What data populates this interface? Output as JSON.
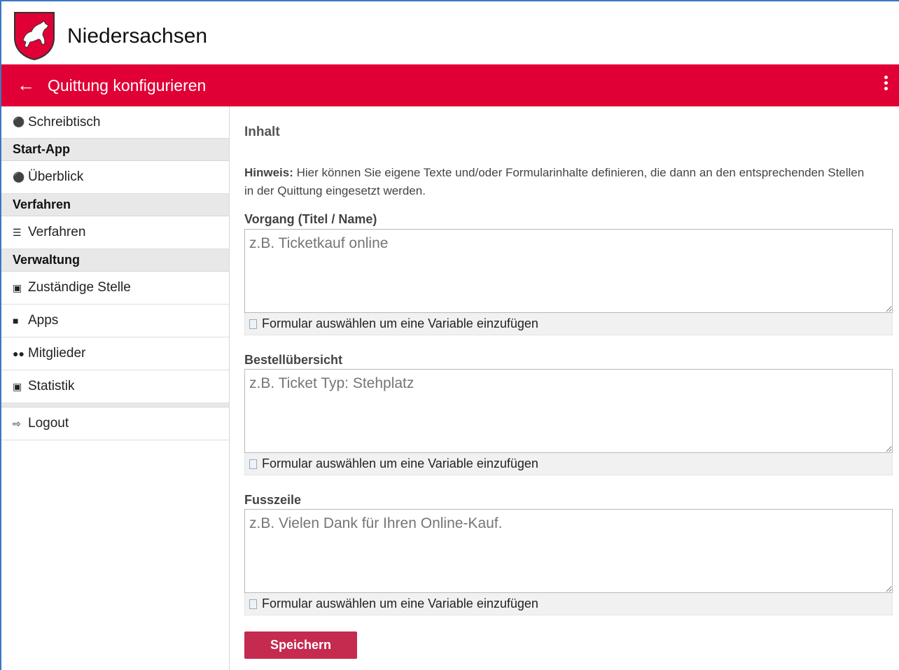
{
  "brand": {
    "name": "Niedersachsen",
    "crest_icon": "horse-crest-icon"
  },
  "topbar": {
    "title": "Quittung konfigurieren",
    "back_icon": "arrow-left-icon",
    "menu_icon": "more-vertical-icon",
    "color": "#e10035"
  },
  "sidebar": {
    "schreibtisch": {
      "label": "Schreibtisch",
      "icon": "home-icon"
    },
    "heading_start": "Start-App",
    "ueberblick": {
      "label": "Überblick",
      "icon": "lightbulb-icon"
    },
    "heading_verfahren": "Verfahren",
    "verfahren": {
      "label": "Verfahren",
      "icon": "list-icon"
    },
    "heading_verwaltung": "Verwaltung",
    "zustaendige": {
      "label": "Zuständige Stelle",
      "icon": "store-icon"
    },
    "apps": {
      "label": "Apps",
      "icon": "apps-icon"
    },
    "mitglieder": {
      "label": "Mitglieder",
      "icon": "people-icon"
    },
    "statistik": {
      "label": "Statistik",
      "icon": "store-icon"
    },
    "logout": {
      "label": "Logout",
      "icon": "logout-icon"
    }
  },
  "content": {
    "section_title": "Inhalt",
    "hint_label": "Hinweis:",
    "hint_text": " Hier können Sie eigene Texte und/oder Formularinhalte definieren, die dann an den entsprechenden Stellen in der Quittung eingesetzt werden.",
    "fields": [
      {
        "label": "Vorgang (Titel / Name)",
        "placeholder": "z.B. Ticketkauf online",
        "value": ""
      },
      {
        "label": "Bestellübersicht",
        "placeholder": "z.B. Ticket Typ: Stehplatz",
        "value": ""
      },
      {
        "label": "Fusszeile",
        "placeholder": "z.B. Vielen Dank für Ihren Online-Kauf.",
        "value": ""
      }
    ],
    "variable_hint": "Formular auswählen um eine Variable einzufügen",
    "save_label": "Speichern",
    "save_color": "#c52a4f"
  }
}
